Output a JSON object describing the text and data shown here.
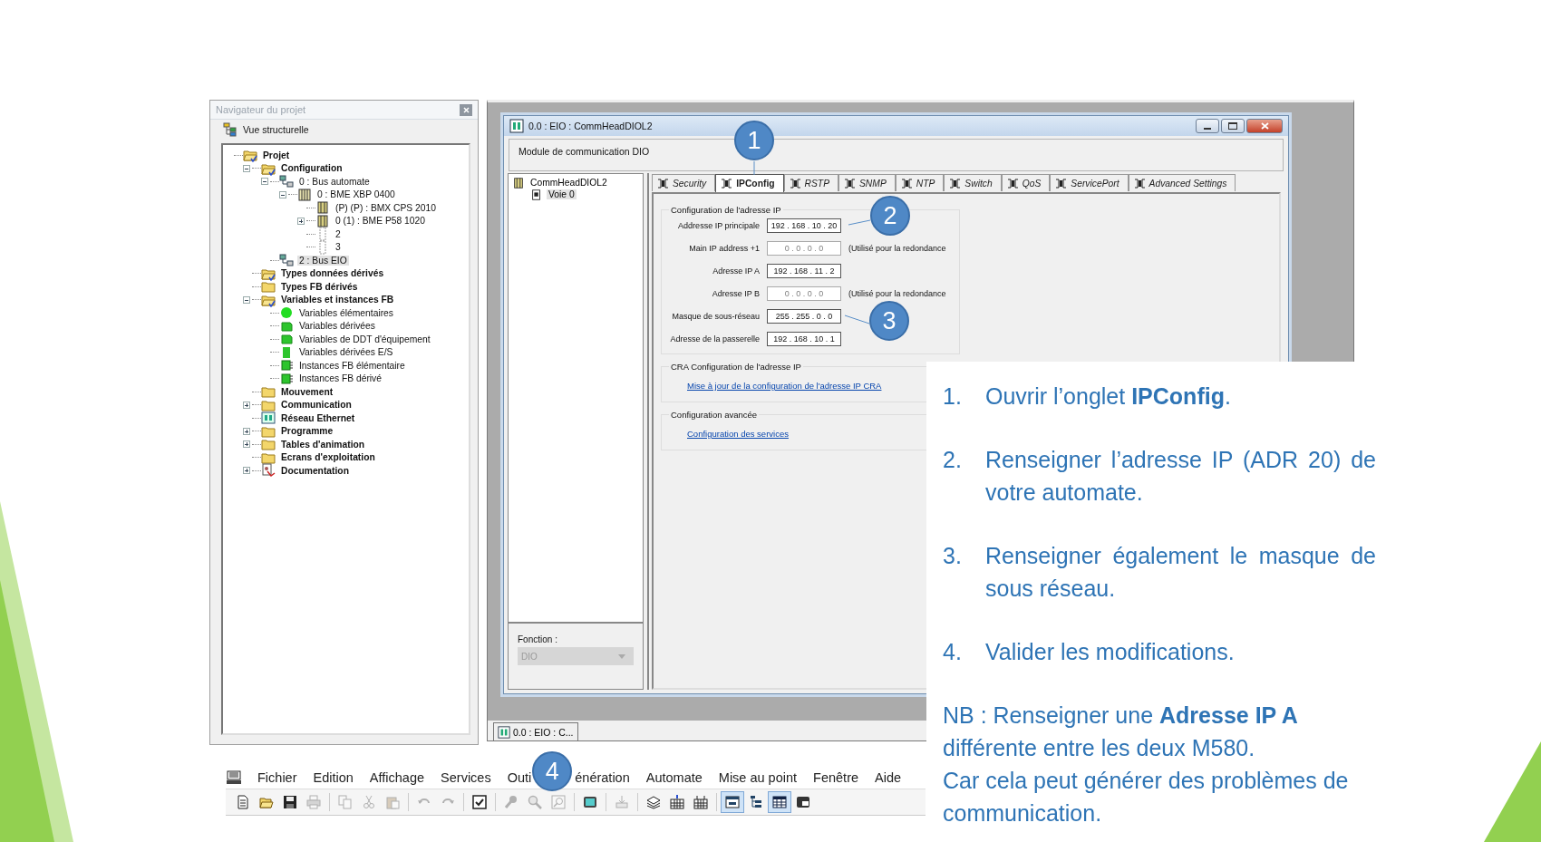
{
  "navigator": {
    "title": "Navigateur du projet",
    "view": "Vue structurelle",
    "tree": [
      {
        "label": "Projet",
        "kind": "folder-open",
        "selected": false,
        "children": [
          {
            "label": "Configuration",
            "kind": "folder-open",
            "expanded": true,
            "selected": false,
            "children": [
              {
                "label": "0 : Bus automate",
                "kind": "bus",
                "expanded": true,
                "selected": false,
                "children": [
                  {
                    "label": "0 : BME XBP 0400",
                    "kind": "rack",
                    "expanded": true,
                    "selected": false,
                    "children": [
                      {
                        "label": "(P) (P) : BMX CPS 2010",
                        "kind": "module",
                        "selected": false
                      },
                      {
                        "label": "0 (1) : BME P58 1020",
                        "kind": "module",
                        "expanded": false,
                        "selected": false
                      },
                      {
                        "label": "2",
                        "kind": "slot",
                        "selected": false
                      },
                      {
                        "label": "3",
                        "kind": "slot",
                        "selected": false
                      }
                    ]
                  }
                ]
              },
              {
                "label": "2 : Bus EIO",
                "kind": "bus",
                "selected": true
              }
            ]
          },
          {
            "label": "Types données dérivés",
            "kind": "folder-open",
            "selected": false
          },
          {
            "label": "Types FB dérivés",
            "kind": "folder",
            "selected": false
          },
          {
            "label": "Variables et instances FB",
            "kind": "folder-open",
            "expanded": true,
            "selected": false,
            "children": [
              {
                "label": "Variables élémentaires",
                "kind": "var-dot",
                "selected": false
              },
              {
                "label": "Variables dérivées",
                "kind": "var-shape",
                "selected": false
              },
              {
                "label": "Variables de DDT d'équipement",
                "kind": "var-shape",
                "selected": false
              },
              {
                "label": "Variables dérivées E/S",
                "kind": "var-square",
                "selected": false
              },
              {
                "label": "Instances FB élémentaire",
                "kind": "fb",
                "selected": false
              },
              {
                "label": "Instances FB dérivé",
                "kind": "fb",
                "selected": false
              }
            ]
          },
          {
            "label": "Mouvement",
            "kind": "folder",
            "selected": false
          },
          {
            "label": "Communication",
            "kind": "folder",
            "expanded": false,
            "selected": false
          },
          {
            "label": "Réseau Ethernet",
            "kind": "network",
            "selected": false
          },
          {
            "label": "Programme",
            "kind": "folder",
            "expanded": false,
            "selected": false
          },
          {
            "label": "Tables d'animation",
            "kind": "folder",
            "expanded": false,
            "selected": false
          },
          {
            "label": "Ecrans d'exploitation",
            "kind": "folder",
            "selected": false
          },
          {
            "label": "Documentation",
            "kind": "doc",
            "expanded": false,
            "selected": false
          }
        ]
      }
    ]
  },
  "dialog": {
    "title": "0.0 : EIO : CommHeadDIOL2",
    "description": "Module de communication DIO",
    "module_tree": [
      {
        "label": "CommHeadDIOL2",
        "kind": "module",
        "selected": false,
        "children": [
          {
            "label": "Voie 0",
            "kind": "channel",
            "selected": true
          }
        ]
      }
    ],
    "function": {
      "label": "Fonction :",
      "value": "DIO",
      "disabled": true
    },
    "tabs": [
      {
        "label": "Security",
        "selected": false
      },
      {
        "label": "IPConfig",
        "selected": true
      },
      {
        "label": "RSTP",
        "selected": false
      },
      {
        "label": "SNMP",
        "selected": false
      },
      {
        "label": "NTP",
        "selected": false
      },
      {
        "label": "Switch",
        "selected": false
      },
      {
        "label": "QoS",
        "selected": false
      },
      {
        "label": "ServicePort",
        "selected": false
      },
      {
        "label": "Advanced Settings",
        "selected": false
      }
    ],
    "ip_group": {
      "title": "Configuration de l'adresse IP",
      "fields": [
        {
          "label": "Addresse IP principale",
          "value": "192 . 168 . 10 . 20",
          "disabled": false
        },
        {
          "label": "Main IP address +1",
          "value": "0 . 0 . 0 . 0",
          "disabled": true,
          "note": "(Utilisé pour la redondance"
        },
        {
          "label": "Adresse IP A",
          "value": "192 . 168 . 11 . 2",
          "disabled": false
        },
        {
          "label": "Adresse IP B",
          "value": "0 . 0 . 0 . 0",
          "disabled": true,
          "note": "(Utilisé pour la redondance"
        },
        {
          "label": "Masque de sous-réseau",
          "value": "255 . 255 . 0 . 0",
          "disabled": false
        },
        {
          "label": "Adresse de la passerelle",
          "value": "192 . 168 . 10 . 1",
          "disabled": false
        }
      ]
    },
    "cra_group": {
      "title": "CRA  Configuration de l'adresse IP",
      "link": "Mise à jour de la configuration de l'adresse IP CRA"
    },
    "advanced_group": {
      "title": "Configuration avancée",
      "link": "Configuration des services"
    }
  },
  "mdi_tab": {
    "label": "0.0 : EIO : C..."
  },
  "menu": [
    "Fichier",
    "Edition",
    "Affichage",
    "Services",
    "Outi",
    "énération",
    "Automate",
    "Mise au point",
    "Fenêtre",
    "Aide"
  ],
  "toolbar": [
    {
      "disabled": false,
      "pressed": false
    },
    {
      "disabled": false,
      "pressed": false
    },
    {
      "disabled": false,
      "pressed": false
    },
    {
      "disabled": true,
      "pressed": false
    },
    {
      "disabled": true,
      "pressed": false
    },
    {
      "disabled": true,
      "pressed": false
    },
    {
      "disabled": true,
      "pressed": false
    },
    {
      "disabled": true,
      "pressed": false
    },
    {
      "disabled": true,
      "pressed": false
    },
    {
      "disabled": false,
      "pressed": false
    },
    {
      "disabled": true,
      "pressed": false
    },
    {
      "disabled": true,
      "pressed": false
    },
    {
      "disabled": true,
      "pressed": false
    },
    {
      "disabled": false,
      "pressed": false
    },
    {
      "disabled": true,
      "pressed": false
    },
    {
      "disabled": false,
      "pressed": false
    },
    {
      "disabled": false,
      "pressed": false
    },
    {
      "disabled": false,
      "pressed": false
    },
    {
      "disabled": false,
      "pressed": true
    },
    {
      "disabled": false,
      "pressed": false
    },
    {
      "disabled": false,
      "pressed": true
    },
    {
      "disabled": false,
      "pressed": false
    }
  ],
  "callouts": [
    "1",
    "2",
    "3",
    "4"
  ],
  "instructions": {
    "steps": [
      {
        "number": "1.",
        "text": "Ouvrir l’onglet **IPConfig**."
      },
      {
        "number": "2.",
        "text": "Renseigner l’adresse IP (ADR 20) de votre automate."
      },
      {
        "number": "3.",
        "text": "Renseigner également le masque de sous réseau."
      },
      {
        "number": "4.",
        "text": "Valider les modifications."
      }
    ],
    "notes": [
      "NB : Renseigner une **Adresse IP A** différente entre les deux M580.",
      "Car cela peut générer des problèmes de communication."
    ]
  }
}
